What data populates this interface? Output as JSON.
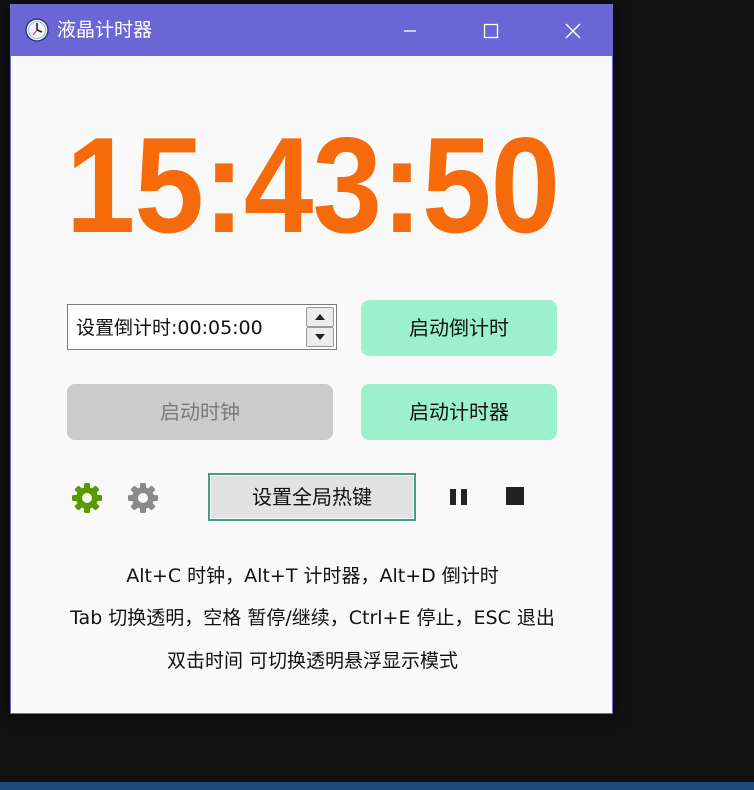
{
  "window": {
    "title": "液晶计时器",
    "app_icon": "clock-icon"
  },
  "titlebar_buttons": {
    "minimize_icon": "minimize-icon",
    "maximize_icon": "maximize-icon",
    "close_icon": "close-icon"
  },
  "clock": {
    "time": "15:43:50",
    "color": "#f56a0a"
  },
  "countdown": {
    "spinbox_value": "设置倒计时:00:05:00",
    "start_countdown_label": "启动倒计时"
  },
  "buttons": {
    "start_clock_label": "启动时钟",
    "start_timer_label": "启动计时器",
    "hotkey_label": "设置全局热键",
    "accent_color": "#9df0ce",
    "disabled_color": "#cccccc"
  },
  "icons": {
    "settings_active": "gear-icon",
    "settings_inactive": "gear-icon",
    "pause": "pause-icon",
    "stop": "stop-icon",
    "settings_active_color": "#5a9a00",
    "settings_inactive_color": "#8a8a8a"
  },
  "help": {
    "line1": "Alt+C 时钟，Alt+T 计时器，Alt+D 倒计时",
    "line2": "Tab 切换透明，空格 暂停/继续，Ctrl+E 停止，ESC 退出",
    "line3": "双击时间 可切换透明悬浮显示模式"
  },
  "theme": {
    "titlebar_color": "#6b66d6"
  }
}
